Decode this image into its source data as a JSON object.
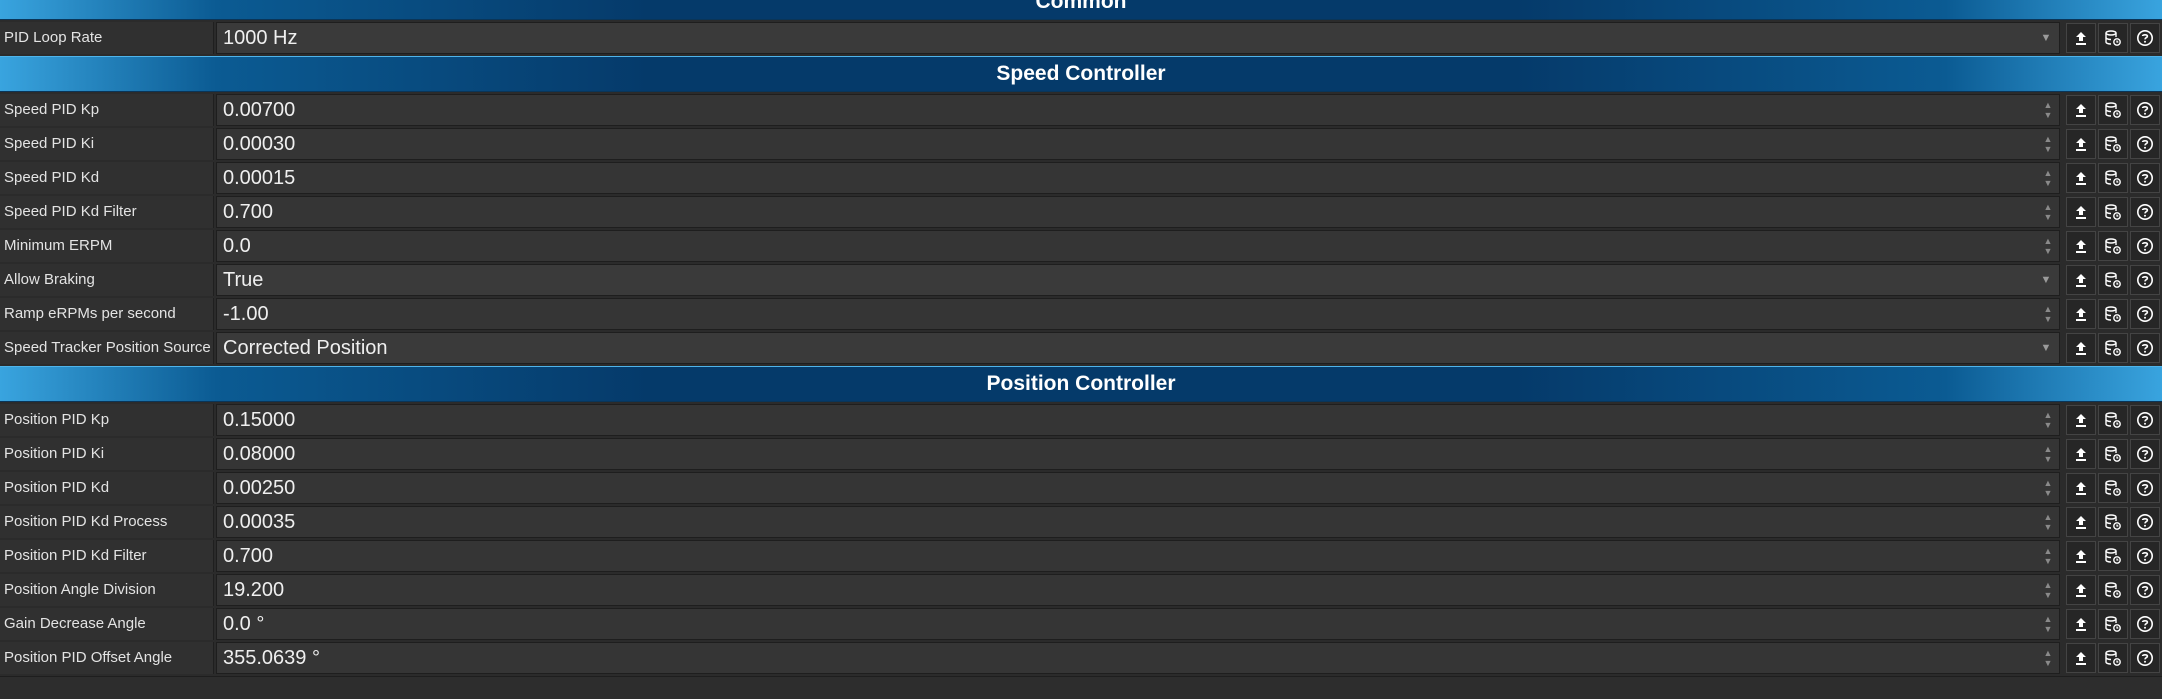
{
  "sections": [
    {
      "title": "Common",
      "rows": [
        {
          "label": "PID Loop Rate",
          "value": "1000 Hz",
          "kind": "combo"
        }
      ]
    },
    {
      "title": "Speed Controller",
      "rows": [
        {
          "label": "Speed PID Kp",
          "value": "0.00700",
          "kind": "spin"
        },
        {
          "label": "Speed PID Ki",
          "value": "0.00030",
          "kind": "spin"
        },
        {
          "label": "Speed PID Kd",
          "value": "0.00015",
          "kind": "spin"
        },
        {
          "label": "Speed PID Kd Filter",
          "value": "0.700",
          "kind": "spin"
        },
        {
          "label": "Minimum ERPM",
          "value": "0.0",
          "kind": "spin"
        },
        {
          "label": "Allow Braking",
          "value": "True",
          "kind": "combo"
        },
        {
          "label": "Ramp eRPMs per second",
          "value": "-1.00",
          "kind": "spin"
        },
        {
          "label": "Speed Tracker Position Source",
          "value": "Corrected Position",
          "kind": "combo"
        }
      ]
    },
    {
      "title": "Position Controller",
      "rows": [
        {
          "label": "Position PID Kp",
          "value": "0.15000",
          "kind": "spin"
        },
        {
          "label": "Position PID Ki",
          "value": "0.08000",
          "kind": "spin"
        },
        {
          "label": "Position PID Kd",
          "value": "0.00250",
          "kind": "spin"
        },
        {
          "label": "Position PID Kd Process",
          "value": "0.00035",
          "kind": "spin"
        },
        {
          "label": "Position PID Kd Filter",
          "value": "0.700",
          "kind": "spin"
        },
        {
          "label": "Position Angle Division",
          "value": "19.200",
          "kind": "spin"
        },
        {
          "label": "Gain Decrease Angle",
          "value": "0.0 °",
          "kind": "spin"
        },
        {
          "label": "Position PID Offset Angle",
          "value": "355.0639 °",
          "kind": "spin"
        }
      ]
    }
  ],
  "icons": {
    "upload": "upload-icon",
    "database": "database-restore-icon",
    "help": "help-icon"
  },
  "colors": {
    "header_dark": "#053a6a",
    "header_light": "#39a4df",
    "background": "#2b2b2b"
  }
}
